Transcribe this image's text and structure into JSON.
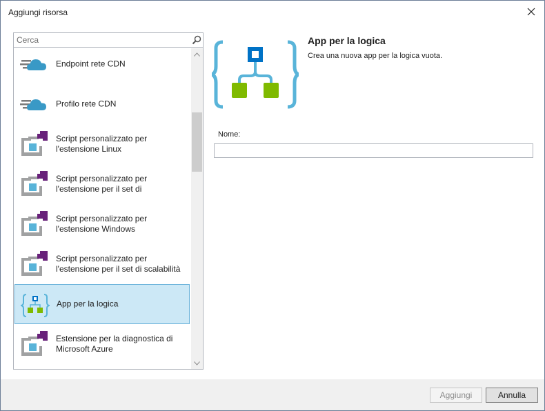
{
  "window": {
    "title": "Aggiungi risorsa",
    "close_icon": "close-icon"
  },
  "search": {
    "placeholder": "Cerca",
    "icon": "search-icon"
  },
  "list": {
    "items": [
      {
        "label": "Endpoint rete CDN",
        "icon": "cdn-cloud-icon",
        "selected": false
      },
      {
        "label": "Profilo rete CDN",
        "icon": "cdn-cloud-icon",
        "selected": false
      },
      {
        "label": "Script personalizzato per l'estensione Linux",
        "icon": "vm-extension-icon",
        "selected": false
      },
      {
        "label": "Script personalizzato per l'estensione per il set di",
        "icon": "vm-extension-icon",
        "selected": false
      },
      {
        "label": "Script personalizzato per l'estensione Windows",
        "icon": "vm-extension-icon",
        "selected": false
      },
      {
        "label": "Script personalizzato per l'estensione per il set di scalabilità",
        "icon": "vm-extension-icon",
        "selected": false
      },
      {
        "label": "App per la logica",
        "icon": "logic-app-icon",
        "selected": true
      },
      {
        "label": "Estensione per la diagnostica di Microsoft Azure",
        "icon": "vm-extension-icon",
        "selected": false
      }
    ]
  },
  "detail": {
    "title": "App per la logica",
    "description": "Crea una nuova app per la logica vuota.",
    "name_label": "Nome:",
    "name_value": ""
  },
  "footer": {
    "add_label": "Aggiungi",
    "cancel_label": "Annulla"
  },
  "colors": {
    "selection_bg": "#cce8f6",
    "selection_border": "#6bb3da",
    "logic_blue": "#59b4d9",
    "logic_dark_blue": "#0072c6",
    "logic_green": "#7fba00",
    "extension_purple": "#68217a",
    "extension_gray": "#a0a1a2",
    "extension_blue": "#59b4d9",
    "cloud_blue": "#3999c6"
  }
}
